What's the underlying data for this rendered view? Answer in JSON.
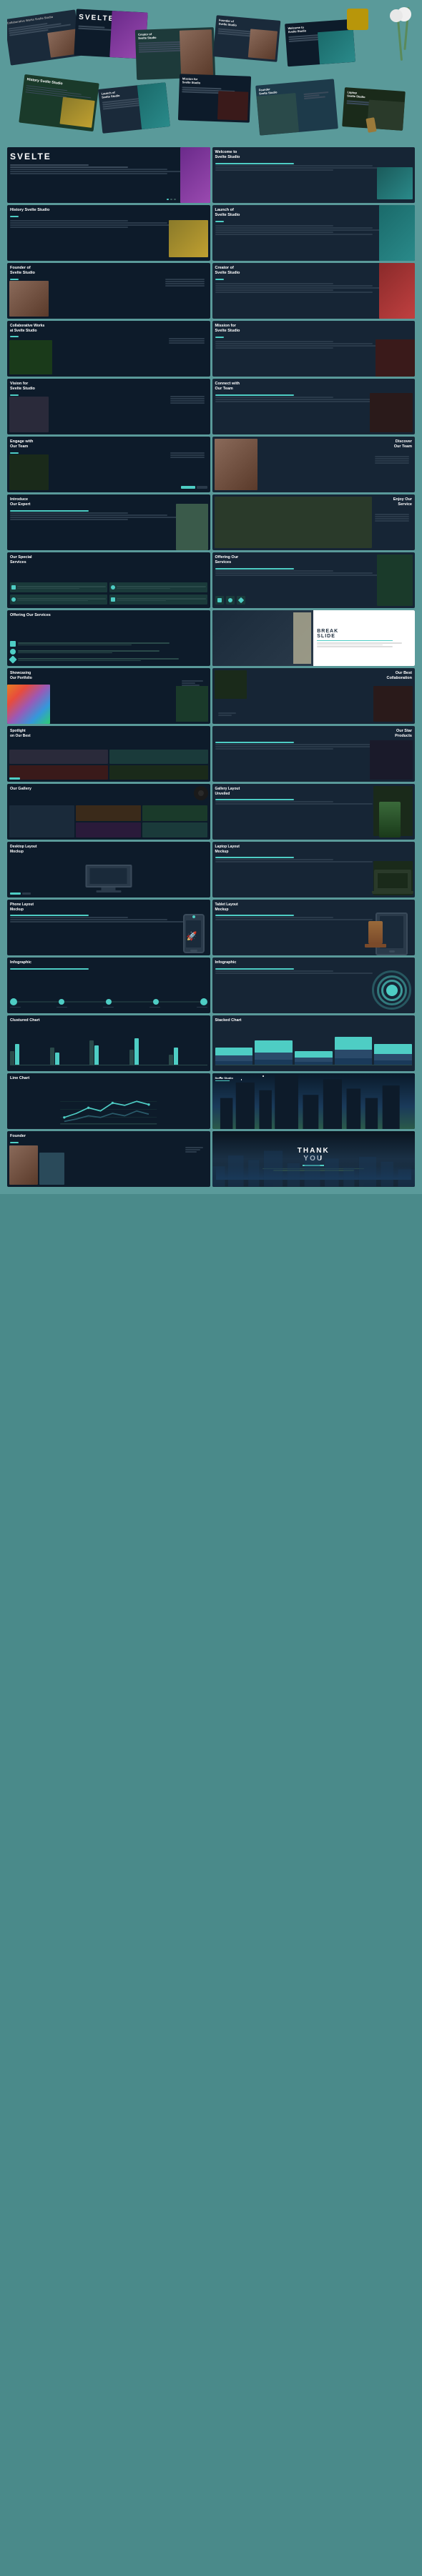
{
  "page": {
    "bg_color": "#5a9a9a"
  },
  "scatter_slides": [
    {
      "title": "Collaborative Works\nSvelte Studio",
      "type": "dark"
    },
    {
      "title": "SVELTE",
      "type": "title"
    },
    {
      "title": "Creator of\nSvelte Studio",
      "type": "teal"
    },
    {
      "title": "Founder of\nSvelte Studio",
      "type": "dark"
    },
    {
      "title": "Welcome to\nSvelte Studio",
      "type": "mid"
    },
    {
      "title": "History\nSvelte Studio",
      "type": "dark"
    },
    {
      "title": "Launch of\nSvelte Studio",
      "type": "mid"
    },
    {
      "title": "Mission for\nSvelte Studio",
      "type": "dark"
    },
    {
      "title": "Founder\nSvelte Studio",
      "type": "teal"
    },
    {
      "title": "Laptop Layout\nSvelte Studio",
      "type": "mid"
    }
  ],
  "grid_slides": [
    {
      "id": "svelte-main",
      "title": "SVELTE",
      "type": "title_slide"
    },
    {
      "id": "welcome",
      "title": "Welcome to Svelte Studio",
      "type": "text_image"
    },
    {
      "id": "history",
      "title": "History Svelte Studio",
      "type": "text_image"
    },
    {
      "id": "launch",
      "title": "Launch of Svelte Studio",
      "type": "text_image"
    },
    {
      "id": "founder",
      "title": "Founder of Svelte Studio",
      "type": "person"
    },
    {
      "id": "creator",
      "title": "Creator of Svelte Studio",
      "type": "person"
    },
    {
      "id": "collaborative",
      "title": "Collaborative Works at Svelte Studio",
      "type": "dark_image"
    },
    {
      "id": "mission",
      "title": "Mission for Svelte Studio",
      "type": "dark_image"
    },
    {
      "id": "vision",
      "title": "Vision for Svelte Studio",
      "type": "dark_image"
    },
    {
      "id": "connect",
      "title": "Connect with Our Team",
      "type": "team"
    },
    {
      "id": "engage",
      "title": "Engage with Our Team",
      "type": "team"
    },
    {
      "id": "discover",
      "title": "Discover Our Team",
      "type": "team"
    },
    {
      "id": "introduce",
      "title": "Introduce Our Expert",
      "type": "person"
    },
    {
      "id": "enjoy",
      "title": "Enjoy Our Service",
      "type": "service"
    },
    {
      "id": "special",
      "title": "Our Special Services",
      "type": "service_icons"
    },
    {
      "id": "offering1",
      "title": "Offering Our Services",
      "type": "service_icons"
    },
    {
      "id": "offering2",
      "title": "Offering Our Services",
      "type": "service_icons"
    },
    {
      "id": "break",
      "title": "BREAK SLIDE",
      "type": "break"
    },
    {
      "id": "showcasing",
      "title": "Showcasing Our Portfolio",
      "type": "portfolio"
    },
    {
      "id": "best-collab",
      "title": "Our Best Collaboration",
      "type": "portfolio"
    },
    {
      "id": "spotlight",
      "title": "Spotlight on Our Best",
      "type": "dark_image"
    },
    {
      "id": "star",
      "title": "Our Star Products",
      "type": "dark_image"
    },
    {
      "id": "gallery",
      "title": "Our Gallery",
      "type": "gallery"
    },
    {
      "id": "gallery-layout",
      "title": "Gallery Layout Unveiled",
      "type": "gallery"
    },
    {
      "id": "desktop",
      "title": "Desktop Layout Mockup",
      "type": "mockup"
    },
    {
      "id": "laptop",
      "title": "Laptop Layout Mockup",
      "type": "mockup"
    },
    {
      "id": "phone",
      "title": "Phone Layout Mockup",
      "type": "mockup"
    },
    {
      "id": "tablet",
      "title": "Tablet Layout Mockup",
      "type": "mockup"
    },
    {
      "id": "infographic1",
      "title": "Infographic",
      "type": "infographic"
    },
    {
      "id": "infographic2",
      "title": "Infographic",
      "type": "infographic"
    },
    {
      "id": "clustered",
      "title": "Clustured Chart",
      "type": "chart_bar"
    },
    {
      "id": "stacked",
      "title": "Stacked Chart",
      "type": "chart_stacked"
    },
    {
      "id": "line",
      "title": "Line Chart",
      "type": "chart_line"
    },
    {
      "id": "svelte-studio",
      "title": "Svelte Studio",
      "type": "studio_slide"
    },
    {
      "id": "founder-end",
      "title": "Founder",
      "type": "founder_end"
    },
    {
      "id": "thank-you",
      "title": "THANK YOU",
      "type": "thank_you"
    }
  ],
  "colors": {
    "teal": "#4ecdc4",
    "dark_bg": "#0d1b2a",
    "mid_bg": "#1a2a3a",
    "teal_bg": "#1d3a3a",
    "white": "#ffffff",
    "accent_purple": "#9b59b6",
    "accent_orange": "#e67e22"
  }
}
